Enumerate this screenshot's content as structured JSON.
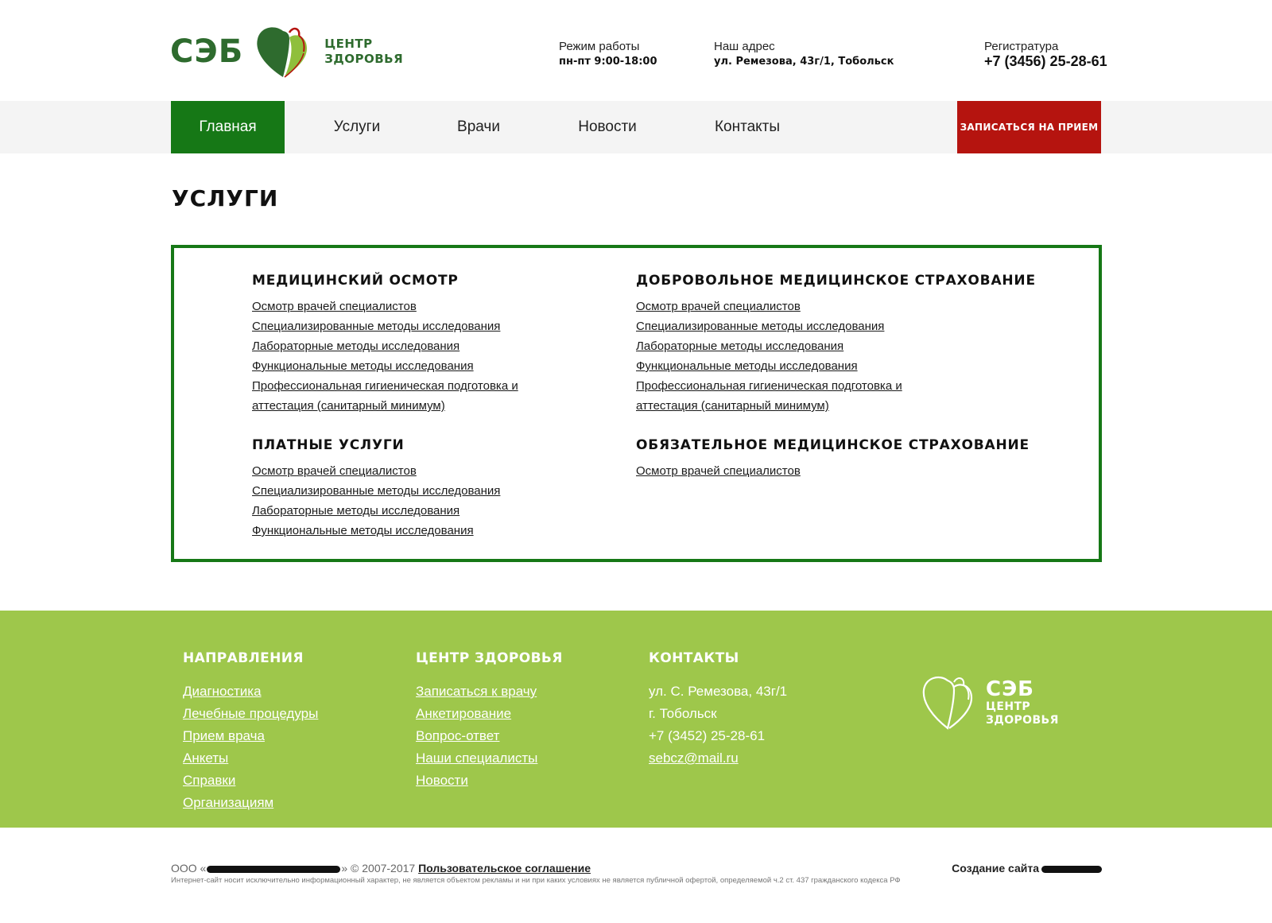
{
  "header": {
    "logo_main": "СЭБ",
    "logo_sub_line1": "ЦЕНТР",
    "logo_sub_line2": "ЗДОРОВЬЯ",
    "hours_label": "Режим работы",
    "hours_value": "пн-пт 9:00-18:00",
    "address_label": "Наш адрес",
    "address_value": "ул. Ремезова, 43г/1, Тобольск",
    "phone_label": "Регистратура",
    "phone_value": "+7 (3456) 25-28-61"
  },
  "nav": {
    "items": [
      "Главная",
      "Услуги",
      "Врачи",
      "Новости",
      "Контакты"
    ],
    "cta": "ЗАПИСАТЬСЯ НА ПРИЕМ"
  },
  "page_title": "УСЛУГИ",
  "services": [
    {
      "title": "МЕДИЦИНСКИЙ ОСМОТР",
      "links": [
        "Осмотр врачей специалистов",
        "Специализированные методы исследования",
        "Лабораторные методы исследования",
        "Функциональные методы исследования",
        "Профессиональная гигиеническая подготовка и аттестация (санитарный минимум)"
      ]
    },
    {
      "title": "ДОБРОВОЛЬНОЕ МЕДИЦИНСКОЕ СТРАХОВАНИЕ",
      "links": [
        "Осмотр врачей специалистов",
        "Специализированные методы исследования",
        "Лабораторные методы исследования",
        "Функциональные методы исследования",
        "Профессиональная гигиеническая подготовка и аттестация (санитарный минимум)"
      ]
    },
    {
      "title": "ПЛАТНЫЕ УСЛУГИ",
      "links": [
        "Осмотр врачей специалистов",
        "Специализированные методы исследования",
        "Лабораторные методы исследования",
        "Функциональные методы исследования"
      ]
    },
    {
      "title": "ОБЯЗАТЕЛЬНОЕ МЕДИЦИНСКОЕ СТРАХОВАНИЕ",
      "links": [
        "Осмотр врачей специалистов"
      ]
    }
  ],
  "footer": {
    "col1": {
      "title": "НАПРАВЛЕНИЯ",
      "links": [
        "Диагностика",
        "Лечебные процедуры",
        "Прием врача",
        "Анкеты",
        "Справки",
        "Организациям"
      ]
    },
    "col2": {
      "title": "ЦЕНТР ЗДОРОВЬЯ",
      "links": [
        "Записаться к врачу",
        "Анкетирование",
        "Вопрос-ответ",
        "Наши специалисты",
        "Новости"
      ]
    },
    "col3": {
      "title": "КОНТАКТЫ",
      "address1": "ул. С. Ремезова, 43г/1",
      "address2": "г. Тобольск",
      "phone": "+7 (3452) 25-28-61",
      "email": "sebcz@mail.ru"
    },
    "logo_main": "СЭБ",
    "logo_sub_line1": "ЦЕНТР",
    "logo_sub_line2": "ЗДОРОВЬЯ"
  },
  "bottom": {
    "copy_prefix": "ООО «",
    "copy_suffix": "» © 2007-2017",
    "agreement": "Пользовательское соглашение",
    "disclaimer": "Интернет-сайт носит исключительно информационный характер, не является объектом рекламы и ни при каких условиях не является публичной офертой, определяемой ч.2 ст. 437 гражданского кодекса РФ",
    "made_label": "Создание сайта"
  },
  "colors": {
    "brand_green": "#167816",
    "logo_green": "#2e6b2e",
    "footer_green": "#9ec74b",
    "cta_red": "#b5140f",
    "nav_bg": "#f4f4f4"
  }
}
